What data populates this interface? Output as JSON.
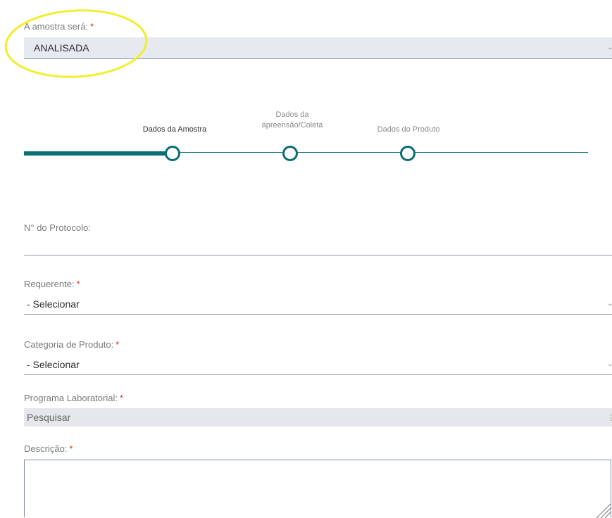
{
  "amostra": {
    "label": "A amostra será:",
    "required": "*",
    "value": "ANALISADA",
    "highlight_color": "#f2ee2c"
  },
  "stepper": {
    "accent_color": "#0a6e72",
    "steps": [
      {
        "label": "Dados da Amostra",
        "active": true
      },
      {
        "label_line1": "Dados da",
        "label_line2": "apreensão/Coleta",
        "active": false
      },
      {
        "label": "Dados do Produto",
        "active": false
      }
    ]
  },
  "protocolo": {
    "label": "N° do Protocolo:",
    "value": ""
  },
  "requerente": {
    "label": "Requerente:",
    "required": "*",
    "value": "- Selecionar"
  },
  "categoria": {
    "label": "Categoria de Produto:",
    "required": "*",
    "value": "- Selecionar"
  },
  "programa": {
    "label": "Programa Laboratorial:",
    "required": "*",
    "placeholder": "Pesquisar"
  },
  "descricao": {
    "label": "Descrição:",
    "required": "*",
    "value": ""
  }
}
